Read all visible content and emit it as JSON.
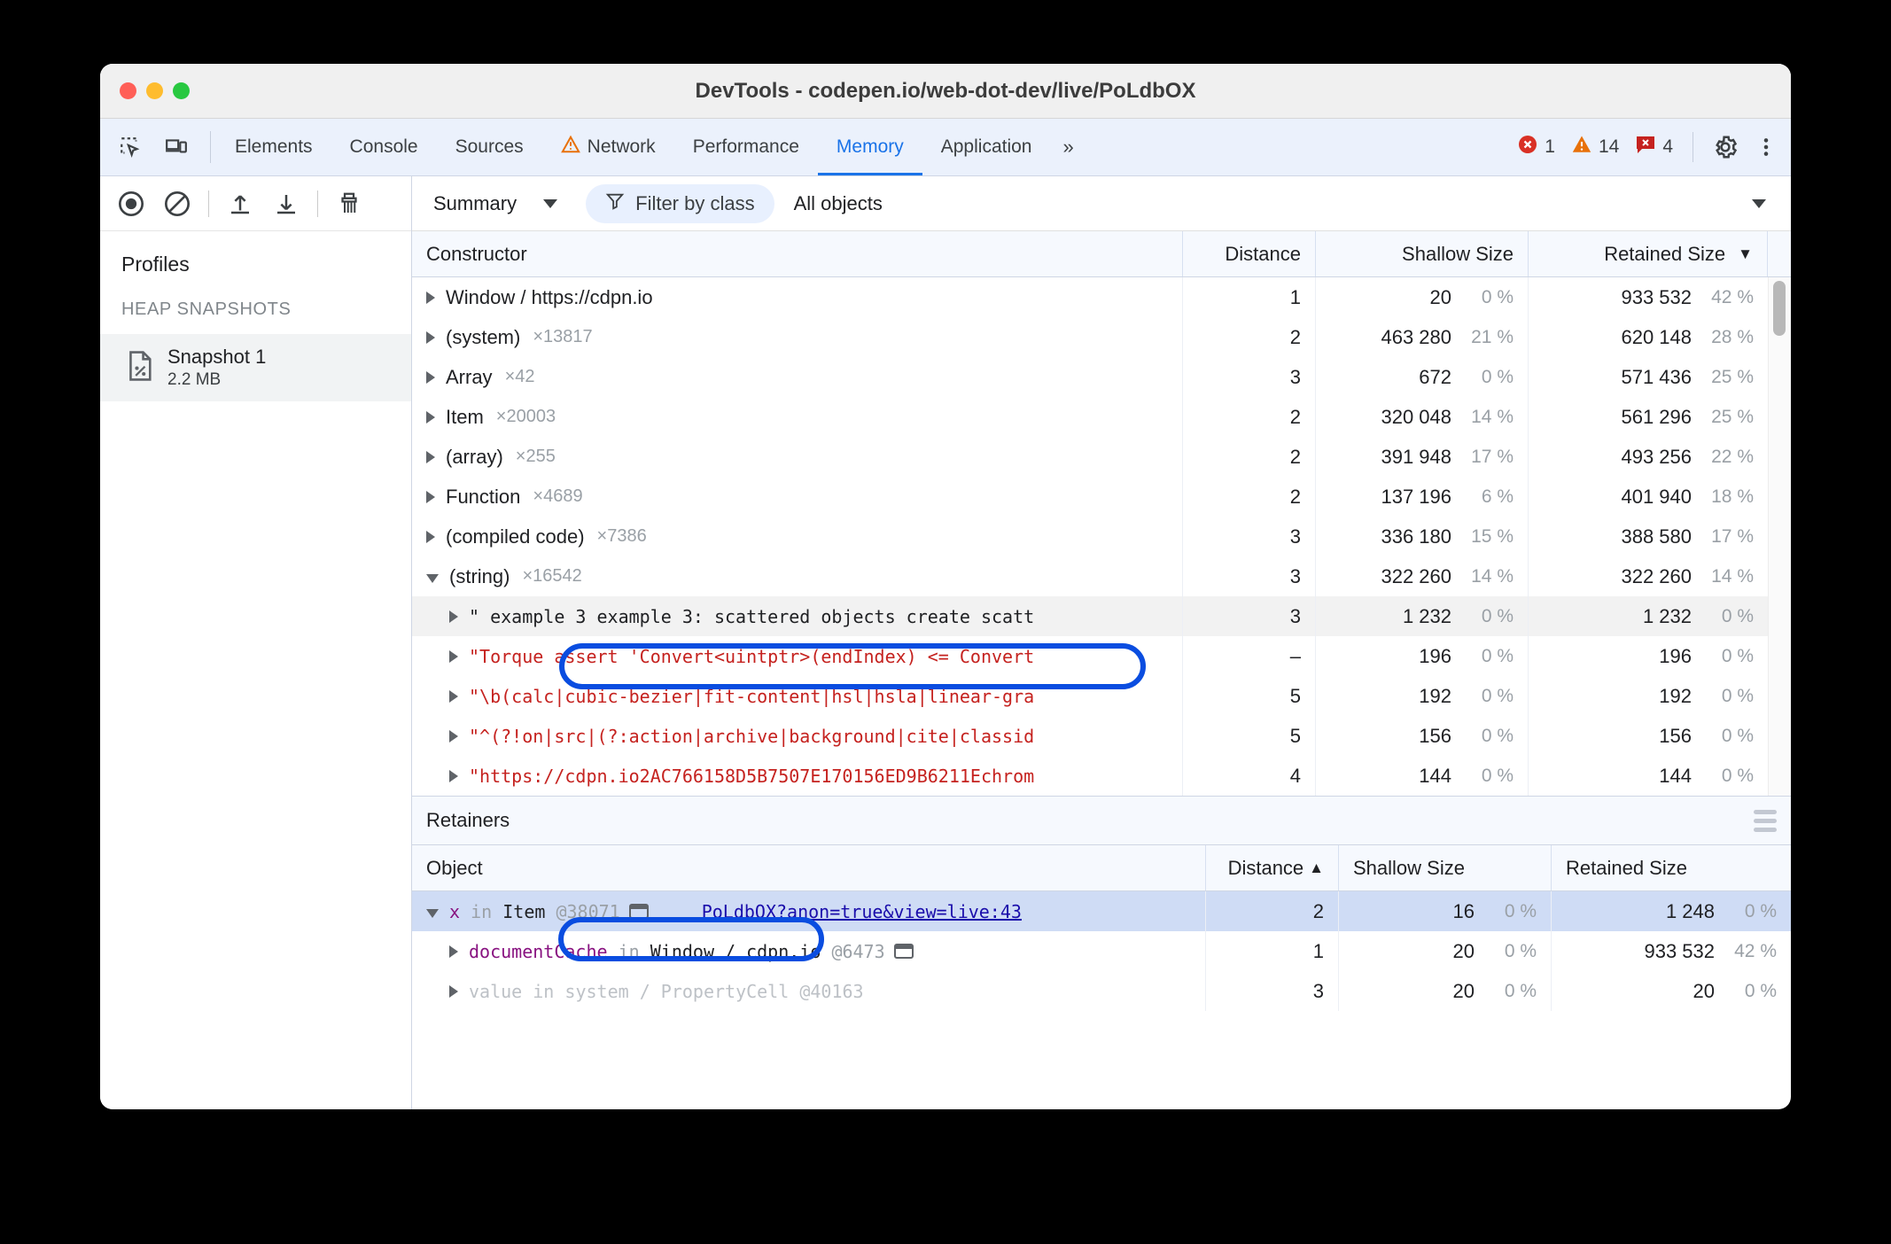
{
  "window": {
    "title": "DevTools - codepen.io/web-dot-dev/live/PoLdbOX"
  },
  "tabbar": {
    "inspect_icon": "inspect-element-icon",
    "device_icon": "device-toolbar-icon",
    "tabs": [
      {
        "label": "Elements",
        "active": false,
        "warn": false
      },
      {
        "label": "Console",
        "active": false,
        "warn": false
      },
      {
        "label": "Sources",
        "active": false,
        "warn": false
      },
      {
        "label": "Network",
        "active": false,
        "warn": true
      },
      {
        "label": "Performance",
        "active": false,
        "warn": false
      },
      {
        "label": "Memory",
        "active": true,
        "warn": false
      },
      {
        "label": "Application",
        "active": false,
        "warn": false
      }
    ],
    "overflow": "»",
    "counters": {
      "errors": "1",
      "warnings": "14",
      "issues": "4"
    },
    "settings_icon": "gear-icon",
    "more_icon": "more-vertical-icon"
  },
  "sidebar": {
    "toolbar": [
      "record-icon",
      "clear-icon",
      "upload-icon",
      "download-icon",
      "trash-icon"
    ],
    "title": "Profiles",
    "section": "HEAP SNAPSHOTS",
    "snapshot": {
      "name": "Snapshot 1",
      "size": "2.2 MB"
    }
  },
  "main_toolbar": {
    "view_select": "Summary",
    "filter_chip": "Filter by class",
    "objects_select": "All objects"
  },
  "constructors": {
    "columns": [
      "Constructor",
      "Distance",
      "Shallow Size",
      "Retained Size"
    ],
    "sorted_by": "Retained Size",
    "sort_dir": "desc",
    "rows": [
      {
        "name": "Window / https://cdpn.io",
        "count": "",
        "distance": "1",
        "shallow": "20",
        "shallow_pct": "0 %",
        "retained": "933 532",
        "retained_pct": "42 %",
        "open": false,
        "mono": false
      },
      {
        "name": "(system)",
        "count": "×13817",
        "distance": "2",
        "shallow": "463 280",
        "shallow_pct": "21 %",
        "retained": "620 148",
        "retained_pct": "28 %",
        "open": false,
        "mono": false
      },
      {
        "name": "Array",
        "count": "×42",
        "distance": "3",
        "shallow": "672",
        "shallow_pct": "0 %",
        "retained": "571 436",
        "retained_pct": "25 %",
        "open": false,
        "mono": false
      },
      {
        "name": "Item",
        "count": "×20003",
        "distance": "2",
        "shallow": "320 048",
        "shallow_pct": "14 %",
        "retained": "561 296",
        "retained_pct": "25 %",
        "open": false,
        "mono": false
      },
      {
        "name": "(array)",
        "count": "×255",
        "distance": "2",
        "shallow": "391 948",
        "shallow_pct": "17 %",
        "retained": "493 256",
        "retained_pct": "22 %",
        "open": false,
        "mono": false
      },
      {
        "name": "Function",
        "count": "×4689",
        "distance": "2",
        "shallow": "137 196",
        "shallow_pct": "6 %",
        "retained": "401 940",
        "retained_pct": "18 %",
        "open": false,
        "mono": false
      },
      {
        "name": "(compiled code)",
        "count": "×7386",
        "distance": "3",
        "shallow": "336 180",
        "shallow_pct": "15 %",
        "retained": "388 580",
        "retained_pct": "17 %",
        "open": false,
        "mono": false
      },
      {
        "name": "(string)",
        "count": "×16542",
        "distance": "3",
        "shallow": "322 260",
        "shallow_pct": "14 %",
        "retained": "322 260",
        "retained_pct": "14 %",
        "open": true,
        "mono": false
      }
    ],
    "string_rows": [
      {
        "text": "\" example 3 example 3: scattered objects create scatt",
        "distance": "3",
        "shallow": "1 232",
        "shallow_pct": "0 %",
        "retained": "1 232",
        "retained_pct": "0 %",
        "selected": true
      },
      {
        "text": "\"Torque assert 'Convert<uintptr>(endIndex) <= Convert",
        "distance": "–",
        "shallow": "196",
        "shallow_pct": "0 %",
        "retained": "196",
        "retained_pct": "0 %",
        "selected": false
      },
      {
        "text": "\"\\b(calc|cubic-bezier|fit-content|hsl|hsla|linear-gra",
        "distance": "5",
        "shallow": "192",
        "shallow_pct": "0 %",
        "retained": "192",
        "retained_pct": "0 %",
        "selected": false
      },
      {
        "text": "\"^(?!on|src|(?:action|archive|background|cite|classid",
        "distance": "5",
        "shallow": "156",
        "shallow_pct": "0 %",
        "retained": "156",
        "retained_pct": "0 %",
        "selected": false
      },
      {
        "text": "\"https://cdpn.io2AC766158D5B7507E170156ED9B6211Echrom",
        "distance": "4",
        "shallow": "144",
        "shallow_pct": "0 %",
        "retained": "144",
        "retained_pct": "0 %",
        "selected": false
      }
    ]
  },
  "retainers": {
    "panel_title": "Retainers",
    "columns": [
      "Object",
      "Distance",
      "Shallow Size",
      "Retained Size"
    ],
    "sorted_by": "Distance",
    "sort_dir": "asc",
    "rows": [
      {
        "key": "x",
        "in": "in",
        "owner": "Item",
        "at": "@38071",
        "has_winbox": true,
        "link": "PoLdbOX?anon=true&view=live:43",
        "distance": "2",
        "shallow": "16",
        "shallow_pct": "0 %",
        "retained": "1 248",
        "retained_pct": "0 %",
        "open": true,
        "selected": true,
        "dim": false,
        "indent": 0
      },
      {
        "key": "documentCache",
        "in": "in",
        "owner": "Window / cdpn.io",
        "at": "@6473",
        "has_winbox": true,
        "link": "",
        "distance": "1",
        "shallow": "20",
        "shallow_pct": "0 %",
        "retained": "933 532",
        "retained_pct": "42 %",
        "open": false,
        "selected": false,
        "dim": false,
        "indent": 1
      },
      {
        "key": "value",
        "in": "in",
        "owner": "system / PropertyCell",
        "at": "@40163",
        "has_winbox": false,
        "link": "",
        "distance": "3",
        "shallow": "20",
        "shallow_pct": "0 %",
        "retained": "20",
        "retained_pct": "0 %",
        "open": false,
        "selected": false,
        "dim": true,
        "indent": 1
      }
    ]
  },
  "annotations": {
    "ring_color": "#0a4de0",
    "ring1_target": "selected string constructor row",
    "ring2_target": "x in Item @38071 retainer row"
  }
}
